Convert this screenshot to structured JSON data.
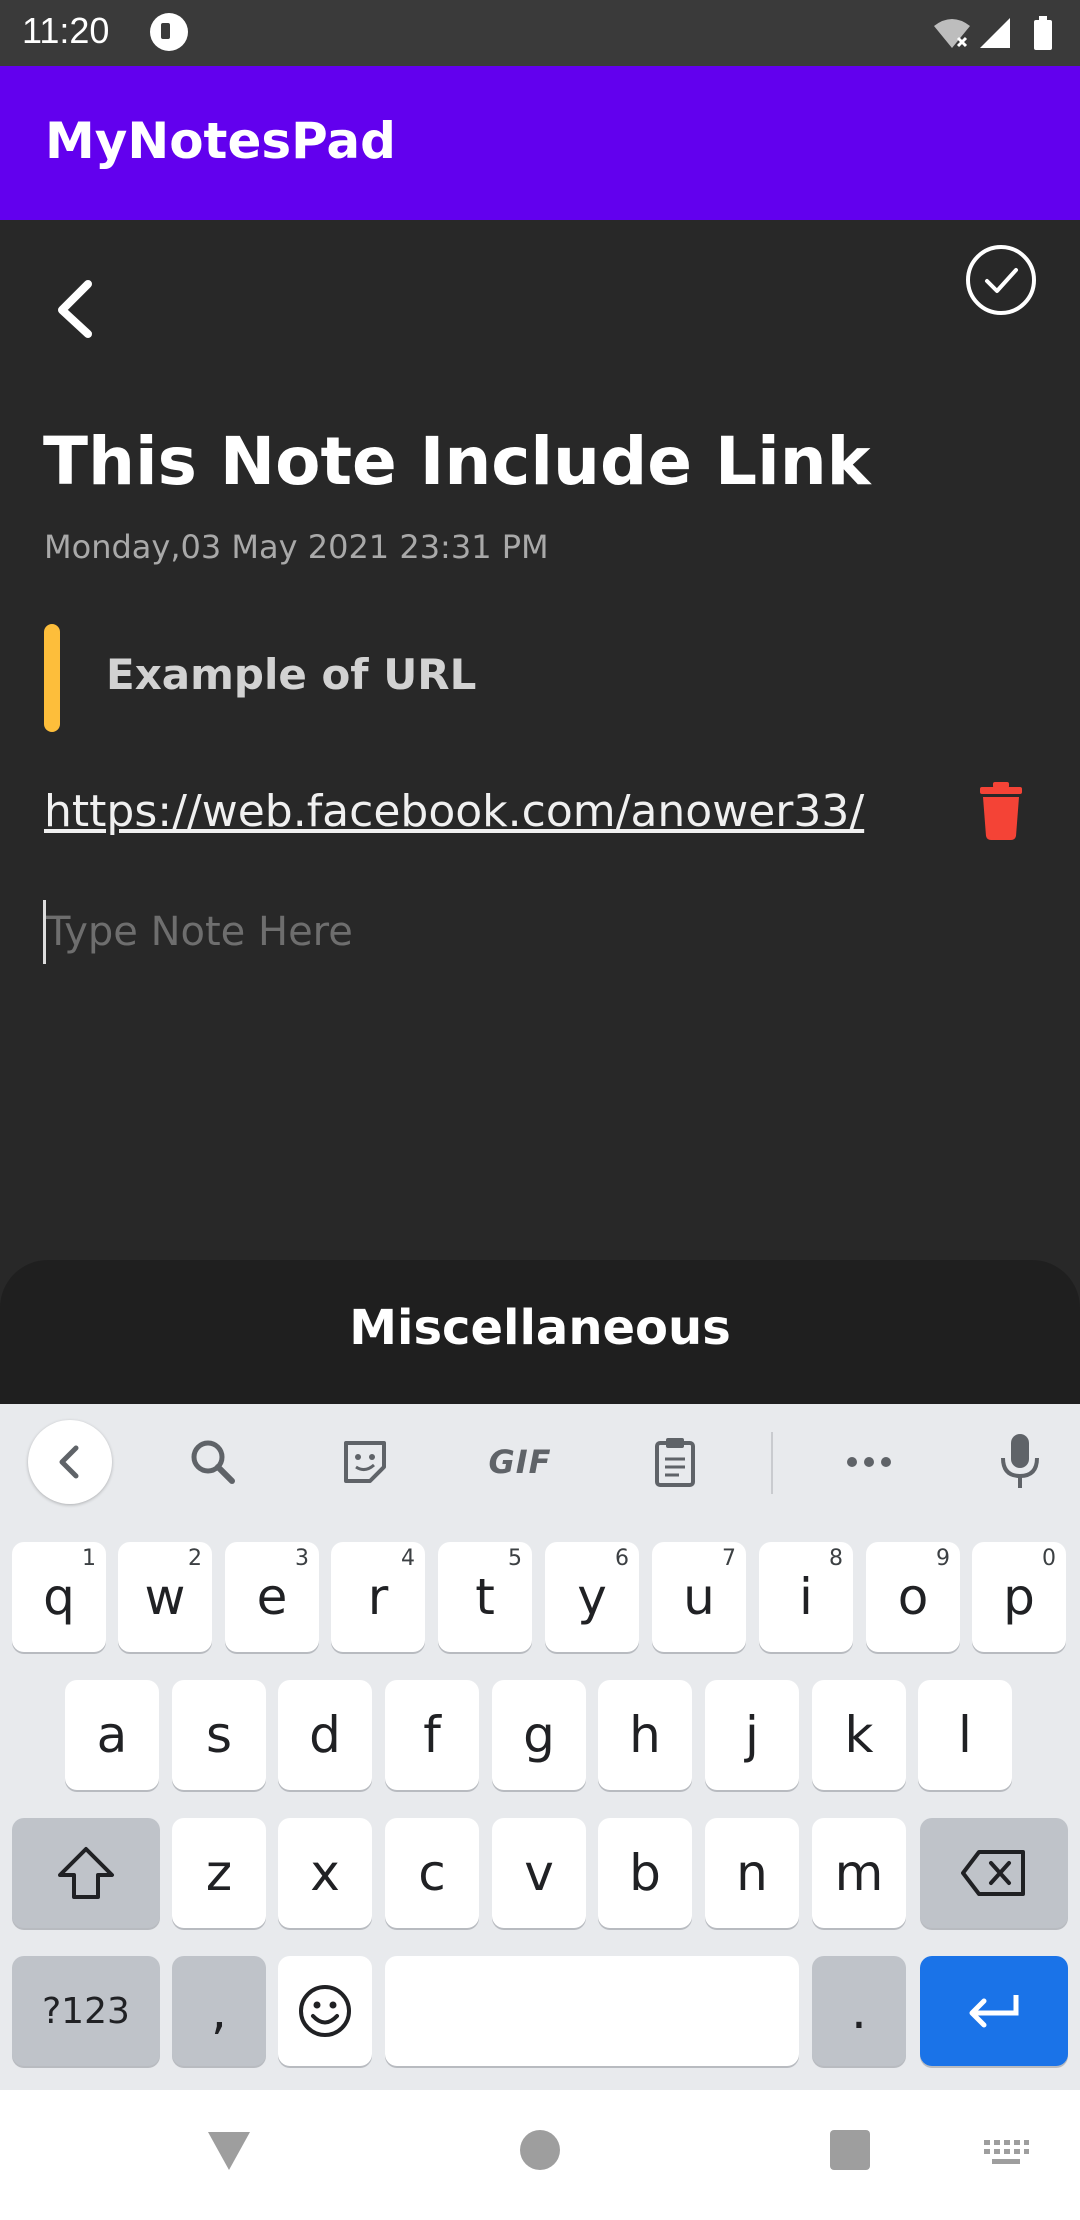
{
  "status_bar": {
    "time": "11:20",
    "icons": [
      "app-notification-icon",
      "wifi-icon",
      "signal-icon",
      "battery-icon"
    ]
  },
  "app_bar": {
    "title": "MyNotesPad",
    "color": "#6200ee"
  },
  "toolbar": {
    "back_icon": "chevron-left-icon",
    "save_icon": "check-circle-icon"
  },
  "note": {
    "title": "This Note Include Link",
    "datetime": "Monday,03 May 2021 23:31 PM",
    "subtitle": "Example of URL",
    "subtitle_indicator_color": "#fdbe3b",
    "url": "https://web.facebook.com/anower33/",
    "delete_icon": "trash-icon",
    "delete_color": "#f44336",
    "text": "",
    "text_placeholder": "Type Note Here"
  },
  "misc_sheet": {
    "title": "Miscellaneous"
  },
  "keyboard": {
    "toolbar": [
      "chevron-left-icon",
      "search-icon",
      "sticker-icon",
      "GIF",
      "clipboard-icon",
      "more-icon",
      "mic-icon"
    ],
    "gif_label": "GIF",
    "row1": [
      {
        "key": "q",
        "hint": "1"
      },
      {
        "key": "w",
        "hint": "2"
      },
      {
        "key": "e",
        "hint": "3"
      },
      {
        "key": "r",
        "hint": "4"
      },
      {
        "key": "t",
        "hint": "5"
      },
      {
        "key": "y",
        "hint": "6"
      },
      {
        "key": "u",
        "hint": "7"
      },
      {
        "key": "i",
        "hint": "8"
      },
      {
        "key": "o",
        "hint": "9"
      },
      {
        "key": "p",
        "hint": "0"
      }
    ],
    "row2": [
      "a",
      "s",
      "d",
      "f",
      "g",
      "h",
      "j",
      "k",
      "l"
    ],
    "row3": [
      "z",
      "x",
      "c",
      "v",
      "b",
      "n",
      "m"
    ],
    "symbols_label": "?123",
    "comma": ",",
    "period": ".",
    "enter_color": "#1a73e8"
  },
  "nav_bar": {
    "icons": [
      "back-triangle-icon",
      "home-circle-icon",
      "recents-square-icon",
      "keyboard-switch-icon"
    ]
  }
}
